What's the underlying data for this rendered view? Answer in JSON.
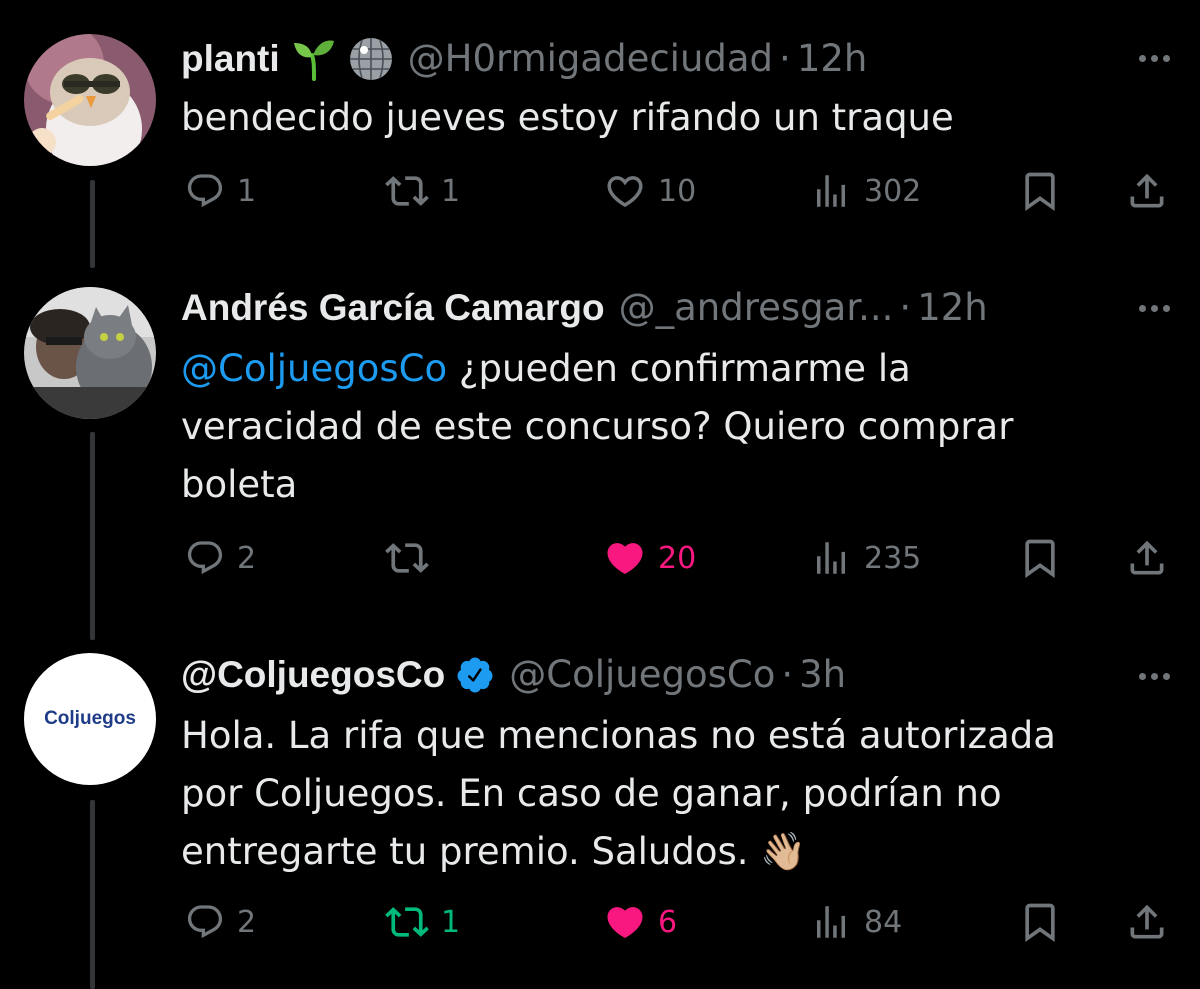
{
  "colors": {
    "background": "#000000",
    "text": "#e7e9ea",
    "muted": "#71767b",
    "mention": "#1d9bf0",
    "like_active": "#f91880",
    "retweet_active": "#00ba7c",
    "verified": "#1d9bf0"
  },
  "tweets": [
    {
      "display_name": "planti",
      "emojis": [
        "🌱",
        "🪩"
      ],
      "handle": "@H0rmigadeciudad",
      "time": "12h",
      "text": "bendecido jueves estoy rifando un traque",
      "reply_count": "1",
      "retweet_count": "1",
      "like_count": "10",
      "view_count": "302",
      "liked": false,
      "retweeted": false
    },
    {
      "display_name": "Andrés García Camargo",
      "handle": "@_andresgar...",
      "time": "12h",
      "mention": "@ColjuegosCo",
      "text_line1": " ¿pueden confirmarme la",
      "text_line2": "veracidad de este concurso? Quiero comprar",
      "text_line3": "boleta",
      "reply_count": "2",
      "retweet_count": "",
      "like_count": "20",
      "view_count": "235",
      "liked": true,
      "retweeted": false
    },
    {
      "display_name": "@ColjuegosCo",
      "verified": true,
      "handle": "@ColjuegosCo",
      "time": "3h",
      "avatar_logo_text": "Coljuegos",
      "text_line1": "Hola. La rifa que mencionas no está autorizada",
      "text_line2": "por Coljuegos. En caso de ganar, podrían no",
      "text_line3": "entregarte tu premio. Saludos.",
      "emoji": "👋🏼",
      "reply_count": "2",
      "retweet_count": "1",
      "like_count": "6",
      "view_count": "84",
      "liked": true,
      "retweeted": true
    }
  ],
  "icons": {
    "reply": "reply-icon",
    "retweet": "retweet-icon",
    "like": "heart-icon",
    "views": "views-icon",
    "bookmark": "bookmark-icon",
    "share": "share-icon",
    "more": "more-icon",
    "verified": "verified-badge-icon"
  }
}
